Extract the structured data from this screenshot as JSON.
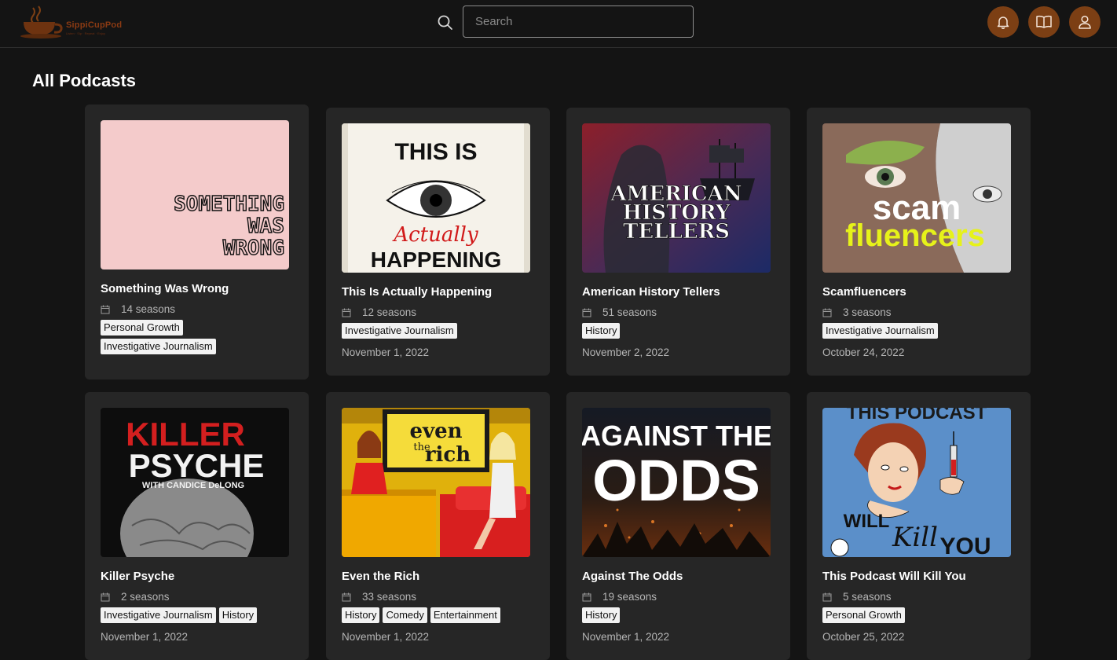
{
  "app": {
    "logo_name": "SippiCupPod",
    "logo_tagline": "Listen · Sip · Repeat · Enjoy"
  },
  "search": {
    "placeholder": "Search"
  },
  "header_icons": [
    "bell-icon",
    "book-icon",
    "user-icon"
  ],
  "accent_color": "#7c3f14",
  "page_title": "All Podcasts",
  "podcasts": [
    {
      "title": "Something Was Wrong",
      "seasons": "14 seasons",
      "tags": [
        "Personal Growth",
        "Investigative Journalism"
      ],
      "date": ""
    },
    {
      "title": "This Is Actually Happening",
      "seasons": "12 seasons",
      "tags": [
        "Investigative Journalism"
      ],
      "date": "November 1, 2022"
    },
    {
      "title": "American History Tellers",
      "seasons": "51 seasons",
      "tags": [
        "History"
      ],
      "date": "November 2, 2022"
    },
    {
      "title": "Scamfluencers",
      "seasons": "3 seasons",
      "tags": [
        "Investigative Journalism"
      ],
      "date": "October 24, 2022"
    },
    {
      "title": "Killer Psyche",
      "seasons": "2 seasons",
      "tags": [
        "Investigative Journalism",
        "History"
      ],
      "date": "November 1, 2022"
    },
    {
      "title": "Even the Rich",
      "seasons": "33 seasons",
      "tags": [
        "History",
        "Comedy",
        "Entertainment"
      ],
      "date": "November 1, 2022"
    },
    {
      "title": "Against The Odds",
      "seasons": "19 seasons",
      "tags": [
        "History"
      ],
      "date": "November 1, 2022"
    },
    {
      "title": "This Podcast Will Kill You",
      "seasons": "5 seasons",
      "tags": [
        "Personal Growth"
      ],
      "date": "October 25, 2022"
    }
  ],
  "covers": {
    "c0": {
      "l1": "SOMETHING",
      "l2": "WAS",
      "l3": "WRONG"
    },
    "c1": {
      "l1": "THIS IS",
      "l2": "Actually",
      "l3": "HAPPENING"
    },
    "c2": {
      "l1": "AMERICAN",
      "l2": "HISTORY",
      "l3": "TELLERS"
    },
    "c3": {
      "l1": "scam",
      "l2": "fluencers"
    },
    "c4": {
      "l1": "KILLER",
      "l2": "PSYCHE",
      "l3": "WITH CANDICE DeLONG"
    },
    "c5": {
      "l1": "even",
      "l2": "the",
      "l3": "rich"
    },
    "c6": {
      "l1": "AGAINST THE",
      "l2": "ODDS"
    },
    "c7": {
      "l1": "THIS PODCAST",
      "l2": "WILL",
      "l3": "Kill",
      "l4": "YOU"
    }
  }
}
